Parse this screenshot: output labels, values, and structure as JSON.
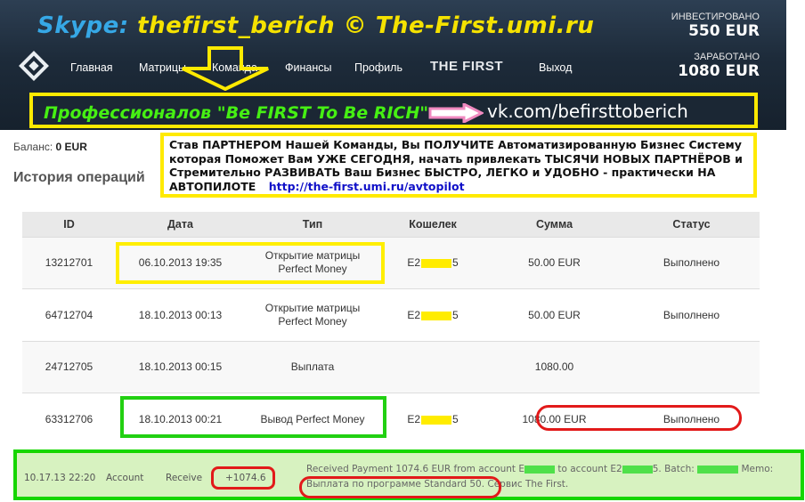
{
  "header": {
    "skype_label": "Skype:",
    "skype_text": "thefirst_berich © The-First.umi.ru",
    "invested_label": "ИНВЕСТИРОВАНО",
    "invested_value": "550 EUR",
    "earned_label": "ЗАРАБОТАНО",
    "earned_value": "1080 EUR"
  },
  "nav": {
    "main": "Главная",
    "matrices": "Матрицы",
    "team": "Команда",
    "finance": "Финансы",
    "profile": "Профиль",
    "brand": "THE FIRST",
    "exit": "Выход"
  },
  "banner": {
    "text": "Профессионалов \"Be FIRST To Be RICH\"",
    "link": "vk.com/befirsttoberich"
  },
  "balance": {
    "label": "Баланс:",
    "value": "0 EUR"
  },
  "history_title": "История операций",
  "promo": {
    "text": "Став ПАРТНЕРОМ Нашей Команды, Вы ПОЛУЧИТЕ Автоматизированную Бизнес Систему которая Поможет Вам УЖЕ СЕГОДНЯ, начать привлекать ТЫСЯЧИ НОВЫХ ПАРТНЁРОВ и Стремительно РАЗВИВАТЬ Ваш Бизнес БЫСТРО, ЛЕГКО и УДОБНО - практически НА АВТОПИЛОТЕ",
    "link": "http://the-first.umi.ru/avtopilot"
  },
  "table": {
    "headers": [
      "ID",
      "Дата",
      "Тип",
      "Кошелек",
      "Сумма",
      "Статус"
    ],
    "rows": [
      {
        "id": "13212701",
        "date": "06.10.2013 19:35",
        "type": [
          "Открытие матрицы",
          "Perfect Money"
        ],
        "wallet_start": "E2",
        "wallet_end": "5",
        "amount": "50.00 EUR",
        "status": "Выполнено"
      },
      {
        "id": "64712704",
        "date": "18.10.2013 00:13",
        "type": [
          "Открытие матрицы",
          "Perfect Money"
        ],
        "wallet_start": "E2",
        "wallet_end": "5",
        "amount": "50.00 EUR",
        "status": "Выполнено"
      },
      {
        "id": "24712705",
        "date": "18.10.2013 00:15",
        "type": [
          "Выплата"
        ],
        "wallet_start": "",
        "wallet_end": "",
        "amount": "1080.00",
        "status": ""
      },
      {
        "id": "63312706",
        "date": "18.10.2013 00:21",
        "type": [
          "Вывод Perfect Money"
        ],
        "wallet_start": "E2",
        "wallet_end": "5",
        "amount": "1080.00 EUR",
        "status": "Выполнено"
      }
    ]
  },
  "receipt": {
    "time": "10.17.13 22:20",
    "account": "Account",
    "receive": "Receive",
    "amount": "+1074.6",
    "memo_a": "Received Payment 1074.6 EUR from account E",
    "memo_b": " to account E2",
    "memo_c": "5. Batch: ",
    "memo_d": " Memo: Выплата по программе Standard 50. Сервис The First."
  },
  "colors": {
    "highlight_yellow": "#ffea00",
    "highlight_green": "#16d600",
    "highlight_red": "#e21a1a",
    "banner_text": "#46f013"
  }
}
